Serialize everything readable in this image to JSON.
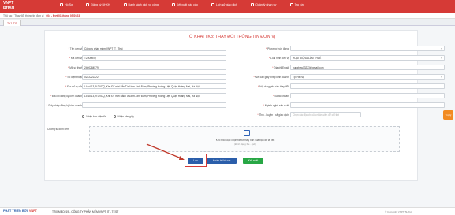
{
  "app": {
    "logo_top": "VNPT",
    "logo_bottom": "BHXH"
  },
  "nav": [
    {
      "label": "Hồ Sơ"
    },
    {
      "label": "Đăng ký BHXH"
    },
    {
      "label": "Danh sách dịch vụ công"
    },
    {
      "label": "Kết xuất báo cáo"
    },
    {
      "label": "Lịch sử giao dịch"
    },
    {
      "label": "Quản lý nhân sự"
    },
    {
      "label": "Tra cứu"
    }
  ],
  "breadcrumb": {
    "path": "Thủ tục / Thay đổi thông tin đơn vị",
    "current": "604 - Đợt 01 tháng 05/2023"
  },
  "tab": {
    "label": "TK1-TS"
  },
  "form": {
    "title": "TỜ KHAI TK3: THAY ĐỔI THÔNG TIN ĐƠN VỊ",
    "left": [
      {
        "label": "Tên đơn vị",
        "value": "Công ty phần mềm VNPT IT - Test",
        "required": true
      },
      {
        "label": "Mã đơn vị",
        "value": "TZ00MEQ",
        "required": true
      },
      {
        "label": "Mã số thuế",
        "value": "2400284579",
        "required": true
      },
      {
        "label": "Số điện thoại",
        "value": "0222222222",
        "required": true
      },
      {
        "label": "Địa chỉ trụ sở",
        "value": "Lô số 13, 9 DVDQ, Khu ĐT mới Bắc Từ Liêm-Linh Đàm, Phường Hoàng Liệt, Quận Hoàng Mai, Hà Nội",
        "required": true
      },
      {
        "label": "Địa chỉ đăng ký kinh doanh",
        "value": "Lô số 13, 9 DVDQ, Khu ĐT mới Bắc Từ Liêm-Linh Đàm, Phường Hoàng Liệt, Quận Hoàng Mai, Hà Nội",
        "required": true
      },
      {
        "label": "Giấy phép đăng ký kinh doanh",
        "value": "",
        "required": true
      }
    ],
    "right": [
      {
        "label": "Phương thức đóng",
        "value": "",
        "required": true,
        "select": true
      },
      {
        "label": "Loại hình đơn vị",
        "value": "HOẠT ĐỘNG LÂM THUÊ",
        "required": true,
        "select": true
      },
      {
        "label": "Địa chỉ Email",
        "value": "hungbow13223@gmail.com",
        "required": true
      },
      {
        "label": "Nơi cấp giấy phép kinh doanh",
        "value": "Tp. Hà Nội",
        "required": true,
        "select": true
      },
      {
        "label": "Nội dung yêu cầu thay đổi",
        "value": "",
        "required": true
      },
      {
        "label": "Số tài khoản",
        "value": "",
        "required": true
      },
      {
        "label": "Ngành nghề sản xuất",
        "value": "",
        "required": true
      },
      {
        "label": "Tỉnh - huyện - xã giao dịch",
        "value": "",
        "placeholder": "Chọn các địa chỉ của nhân viên để chỉ tiết",
        "required": true
      }
    ],
    "radio_paper": "Nhận bản điện tử",
    "radio_online": "Nhận bản giấy",
    "attachment_label": "Chứng từ đính kèm",
    "upload_text": "Kéo thả hoặc chọn file từ máy tính của bạn để tải lên",
    "upload_hint": "(Định dạng file ...pdf)"
  },
  "buttons": {
    "save": "Lưu",
    "done": "Hoàn tất hồ sơ",
    "export": "Kết xuất"
  },
  "side_help": "Trợ lý",
  "footer": {
    "brand": "PHẦT TRIỂN BỞI",
    "brand_v": "VNPT",
    "company": "TZ00MEQ219 - CÔNG TY PHẦN MỀM VNPT IT - TEST",
    "copy": "© Copyright VNPT BHXH"
  },
  "colors": {
    "primary": "#d63a36",
    "button_blue": "#2b5eaa",
    "button_green": "#28a745"
  }
}
